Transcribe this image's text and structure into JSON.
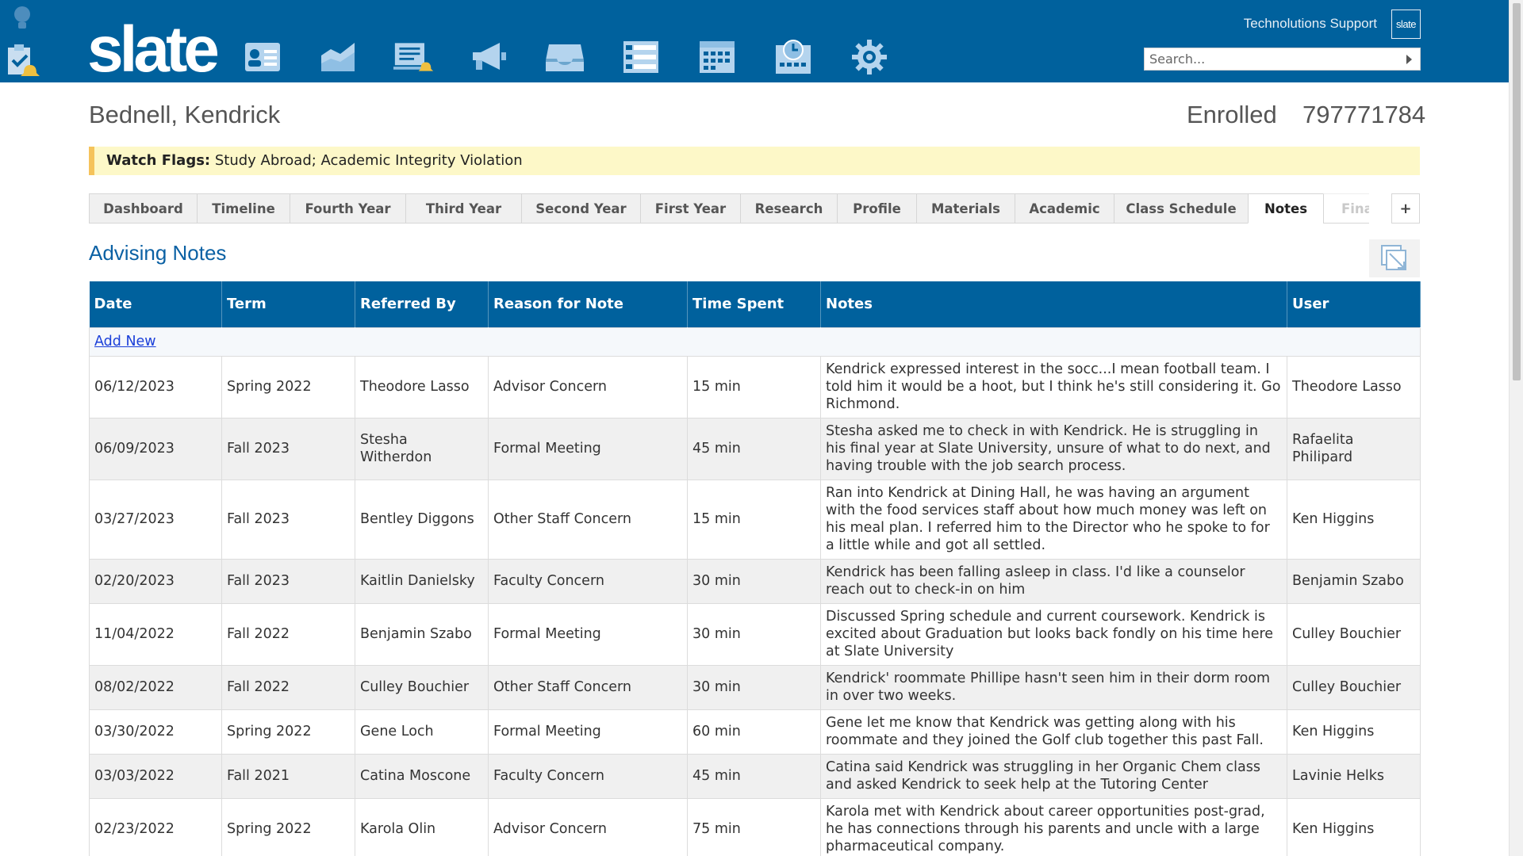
{
  "header": {
    "logo": "slate",
    "support_user": "Technolutions Support",
    "badge": "slate",
    "search_placeholder": "Search...",
    "nav_icons": [
      "contact-card-icon",
      "chart-area-icon",
      "reader-alert-icon",
      "megaphone-icon",
      "inbox-icon",
      "list-icon",
      "calendar-icon",
      "schedule-icon",
      "gear-icon"
    ],
    "colors": {
      "bar": "#00619d",
      "icon": "#9ec9e8"
    }
  },
  "person": {
    "name": "Bednell, Kendrick",
    "status": "Enrolled",
    "id": "797771784"
  },
  "watch_flags": {
    "label": "Watch Flags:",
    "value": "Study Abroad; Academic Integrity Violation"
  },
  "tabs": [
    {
      "label": "Dashboard"
    },
    {
      "label": "Timeline"
    },
    {
      "label": "Fourth Year"
    },
    {
      "label": "Third Year"
    },
    {
      "label": "Second Year"
    },
    {
      "label": "First Year"
    },
    {
      "label": "Research"
    },
    {
      "label": "Profile"
    },
    {
      "label": "Materials"
    },
    {
      "label": "Academic"
    },
    {
      "label": "Class Schedule"
    },
    {
      "label": "Notes",
      "active": true
    },
    {
      "label": "Fina"
    }
  ],
  "tab_add": "+",
  "section": {
    "title": "Advising Notes"
  },
  "table": {
    "columns": [
      "Date",
      "Term",
      "Referred By",
      "Reason for Note",
      "Time Spent",
      "Notes",
      "User"
    ],
    "add_new": "Add New",
    "rows": [
      {
        "date": "06/12/2023",
        "term": "Spring 2022",
        "referred_by": "Theodore Lasso",
        "reason": "Advisor Concern",
        "time": "15 min",
        "notes": "Kendrick expressed interest in the socc...I mean football team. I told him it would be a hoot, but I think he's still considering it. Go Richmond.",
        "user": "Theodore Lasso"
      },
      {
        "date": "06/09/2023",
        "term": "Fall 2023",
        "referred_by": "Stesha Witherdon",
        "reason": "Formal Meeting",
        "time": "45 min",
        "notes": "Stesha asked me to check in with Kendrick. He is struggling in his final year at Slate University, unsure of what to do next, and having trouble with the job search process.",
        "user": "Rafaelita Philipard"
      },
      {
        "date": "03/27/2023",
        "term": "Fall 2023",
        "referred_by": "Bentley Diggons",
        "reason": "Other Staff Concern",
        "time": "15 min",
        "notes": "Ran into Kendrick at Dining Hall, he was having an argument with the food services staff about how much money was left on his meal plan. I referred him to the Director who he spoke to for a little while and got all settled.",
        "user": "Ken Higgins"
      },
      {
        "date": "02/20/2023",
        "term": "Fall 2023",
        "referred_by": "Kaitlin Danielsky",
        "reason": "Faculty Concern",
        "time": "30 min",
        "notes": "Kendrick has been falling asleep in class. I'd like a counselor reach out to check-in on him",
        "user": "Benjamin Szabo"
      },
      {
        "date": "11/04/2022",
        "term": "Fall 2022",
        "referred_by": "Benjamin Szabo",
        "reason": "Formal Meeting",
        "time": "30 min",
        "notes": "Discussed Spring schedule and current coursework. Kendrick is excited about Graduation but looks back fondly on his time here at Slate University",
        "user": "Culley Bouchier"
      },
      {
        "date": "08/02/2022",
        "term": "Fall 2022",
        "referred_by": "Culley Bouchier",
        "reason": "Other Staff Concern",
        "time": "30 min",
        "notes": "Kendrick' roommate Phillipe hasn't seen him in their dorm room in over two weeks.",
        "user": "Culley Bouchier"
      },
      {
        "date": "03/30/2022",
        "term": "Spring 2022",
        "referred_by": "Gene Loch",
        "reason": "Formal Meeting",
        "time": "60 min",
        "notes": "Gene let me know that Kendrick was getting along with his roommate and they joined the Golf club together this past Fall.",
        "user": "Ken Higgins"
      },
      {
        "date": "03/03/2022",
        "term": "Fall 2021",
        "referred_by": "Catina Moscone",
        "reason": "Faculty Concern",
        "time": "45 min",
        "notes": "Catina said Kendrick was struggling in her Organic Chem class and asked Kendrick to seek help at the Tutoring Center",
        "user": "Lavinie Helks"
      },
      {
        "date": "02/23/2022",
        "term": "Spring 2022",
        "referred_by": "Karola Olin",
        "reason": "Advisor Concern",
        "time": "75 min",
        "notes": "Karola met with Kendrick about career opportunities post-grad, he has connections through his parents and uncle with a large pharmaceutical company.",
        "user": "Ken Higgins"
      }
    ]
  }
}
